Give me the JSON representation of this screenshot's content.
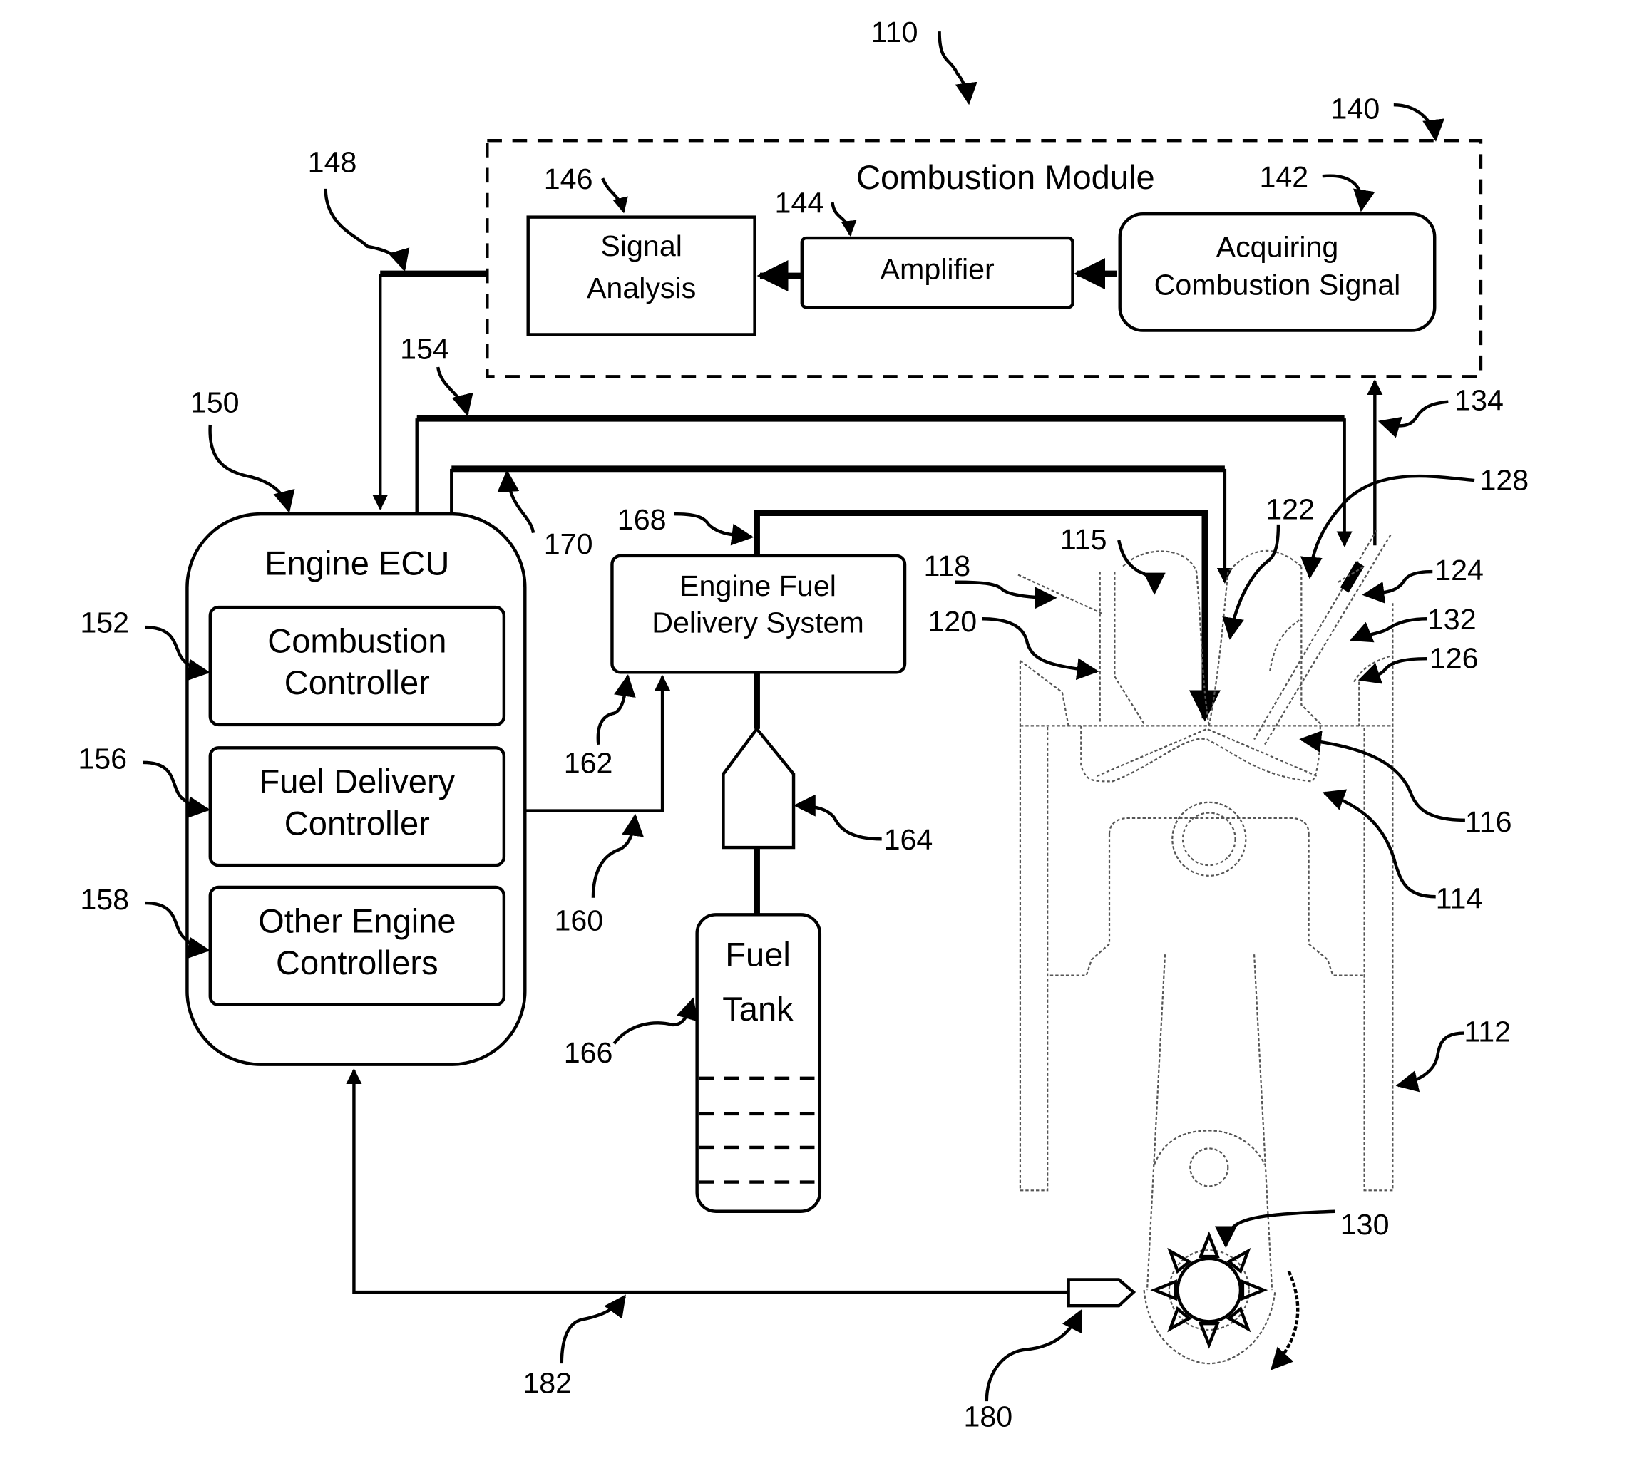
{
  "figure": {
    "ref": "110",
    "combustion_module": {
      "ref": "140",
      "title": "Combustion Module",
      "signal_analysis": {
        "ref": "146",
        "line1": "Signal",
        "line2": "Analysis"
      },
      "amplifier": {
        "ref": "144",
        "label": "Amplifier"
      },
      "acquiring": {
        "ref": "142",
        "line1": "Acquiring",
        "line2": "Combustion Signal"
      }
    },
    "ecu": {
      "ref": "150",
      "title": "Engine ECU",
      "combustion_controller": {
        "ref": "152",
        "line1": "Combustion",
        "line2": "Controller"
      },
      "fuel_delivery_controller": {
        "ref": "156",
        "line1": "Fuel Delivery",
        "line2": "Controller"
      },
      "other_controllers": {
        "ref": "158",
        "line1": "Other Engine",
        "line2": "Controllers"
      }
    },
    "fuel_system": {
      "ref": "162",
      "line1": "Engine Fuel",
      "line2": "Delivery System",
      "pump_ref": "164",
      "tank": {
        "ref": "166",
        "line1": "Fuel",
        "line2": "Tank"
      },
      "line_ref": "168"
    },
    "signals": {
      "s148": "148",
      "s154": "154",
      "s170": "170",
      "s160": "160",
      "s134": "134",
      "s182": "182"
    },
    "engine": {
      "cylinder": "112",
      "piston": "114",
      "chamber": "115",
      "bowl": "116",
      "intake_port": "118",
      "intake_valve": "120",
      "injector": "122",
      "glow_plug": "124",
      "exhaust_valve": "126",
      "sensor": "128",
      "crank_wheel": "130",
      "sensor_tip": "132",
      "crank_sensor": "180"
    }
  }
}
